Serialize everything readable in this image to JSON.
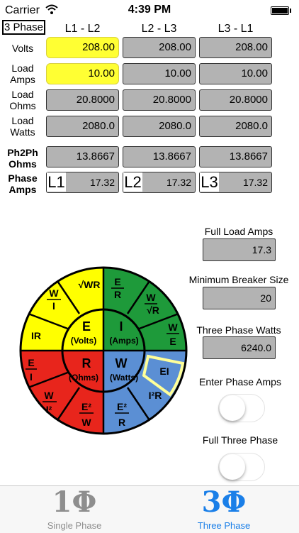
{
  "status_bar": {
    "carrier": "Carrier",
    "time": "4:39 PM"
  },
  "mode_label": "3 Phase",
  "columns": [
    "L1 - L2",
    "L2 - L3",
    "L3 - L1"
  ],
  "rows": {
    "volts": {
      "label": "Volts",
      "values": [
        "208.00",
        "208.00",
        "208.00"
      ]
    },
    "load_amps": {
      "label_line1": "Load",
      "label_line2": "Amps",
      "values": [
        "10.00",
        "10.00",
        "10.00"
      ]
    },
    "load_ohms": {
      "label_line1": "Load",
      "label_line2": "Ohms",
      "values": [
        "20.8000",
        "20.8000",
        "20.8000"
      ]
    },
    "load_watts": {
      "label_line1": "Load",
      "label_line2": "Watts",
      "values": [
        "2080.0",
        "2080.0",
        "2080.0"
      ]
    },
    "ph2ph_ohms": {
      "label_line1": "Ph2Ph",
      "label_line2": "Ohms",
      "values": [
        "13.8667",
        "13.8667",
        "13.8667"
      ]
    },
    "phase_amps": {
      "label_line1": "Phase",
      "label_line2": "Amps",
      "tags": [
        "L1",
        "L2",
        "L3"
      ],
      "values": [
        "17.32",
        "17.32",
        "17.32"
      ]
    }
  },
  "results": {
    "full_load_amps": {
      "label": "Full Load Amps",
      "value": "17.3"
    },
    "min_breaker": {
      "label": "Minimum Breaker Size",
      "value": "20"
    },
    "three_phase_watts": {
      "label": "Three Phase Watts",
      "value": "6240.0"
    }
  },
  "toggles": {
    "enter_phase_amps": {
      "label": "Enter Phase Amps",
      "on": false
    },
    "full_three_phase": {
      "label": "Full Three Phase",
      "on": false
    }
  },
  "wheel": {
    "center": [
      {
        "big": "E",
        "small": "(Volts)"
      },
      {
        "big": "I",
        "small": "(Amps)"
      },
      {
        "big": "R",
        "small": "(Ohms)"
      },
      {
        "big": "W",
        "small": "(Watts)"
      }
    ],
    "segments": {
      "ir": "IR",
      "ei": "EI",
      "i2r": "I²R",
      "sqrt_wr": "√WR"
    },
    "colors": {
      "yellow": "#ffff00",
      "green": "#1e9a3a",
      "red": "#e8251c",
      "blue": "#5b8fd4",
      "highlight": "#ffff99"
    }
  },
  "tabs": [
    {
      "glyph": "1Φ",
      "label": "Single Phase",
      "active": false
    },
    {
      "glyph": "3Φ",
      "label": "Three Phase",
      "active": true
    }
  ],
  "colors": {
    "accent": "#1a7fe8",
    "input": "#ffff33",
    "output": "#b3b3b3"
  }
}
